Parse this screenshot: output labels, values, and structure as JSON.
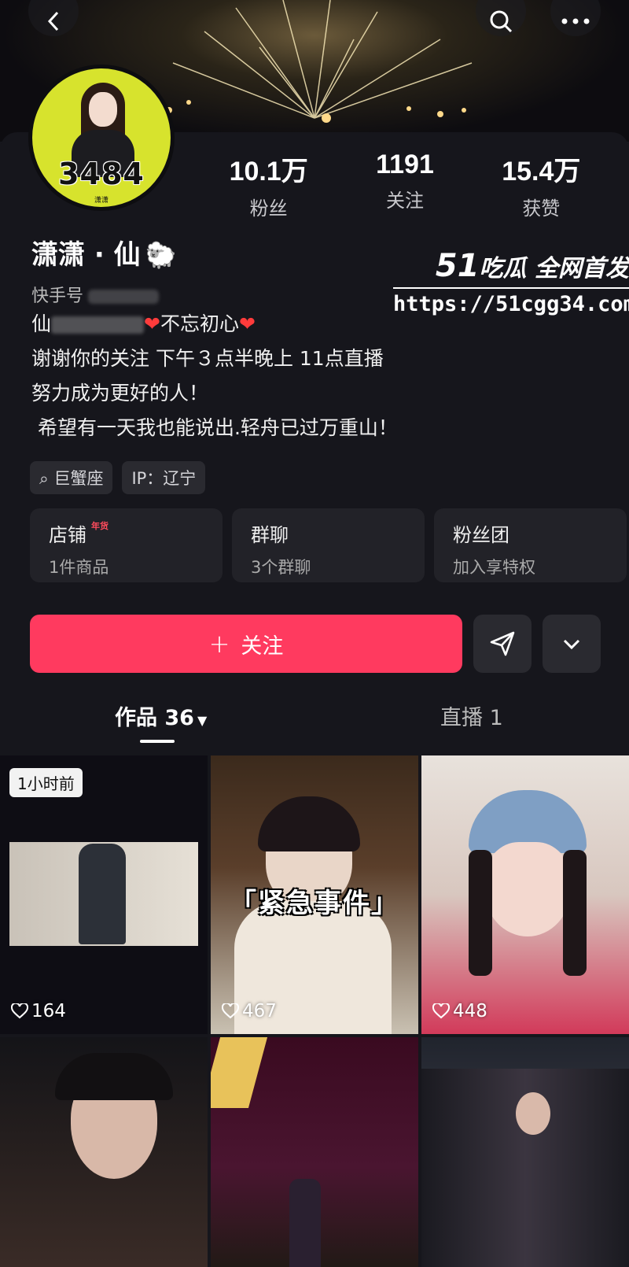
{
  "header": {
    "back_icon": "chevron-left-icon",
    "search_icon": "search-icon",
    "more_icon": "more-horizontal-icon"
  },
  "avatar": {
    "number": "3484",
    "sub": "潇潇"
  },
  "stats": [
    {
      "value": "10.1万",
      "label": "粉丝"
    },
    {
      "value": "1191",
      "label": "关注"
    },
    {
      "value": "15.4万",
      "label": "获赞"
    }
  ],
  "profile": {
    "name": "潇潇 · 仙",
    "id_label": "快手号",
    "bio_line1_prefix": "仙",
    "bio_line1_suffix": "不忘初心",
    "bio_line2": "谢谢你的关注 下午３点半晚上 11点直播",
    "bio_line3": "努力成为更好的人！",
    "bio_line4": " 希望有一天我也能说出.轻舟已过万重山！"
  },
  "tags": [
    "巨蟹座",
    "IP：辽宁"
  ],
  "features": [
    {
      "title": "店铺",
      "badge": "年货",
      "sub": "1件商品"
    },
    {
      "title": "群聊",
      "sub": "3个群聊"
    },
    {
      "title": "粉丝团",
      "sub": "加入享特权"
    }
  ],
  "actions": {
    "follow_label": "关注"
  },
  "tabs": {
    "works_label": "作品 36",
    "live_label": "直播 1"
  },
  "grid": {
    "time_badge": "1小时前",
    "overlay_text": "「紧急事件」",
    "likes": [
      "164",
      "467",
      "448"
    ]
  },
  "watermark": {
    "title_num": "51",
    "title_text": "吃瓜 全网首发",
    "url": "https://51cgg34.com"
  },
  "colors": {
    "accent": "#ff3a5f",
    "background": "#16161c",
    "avatar_bg": "#d7e32d"
  }
}
